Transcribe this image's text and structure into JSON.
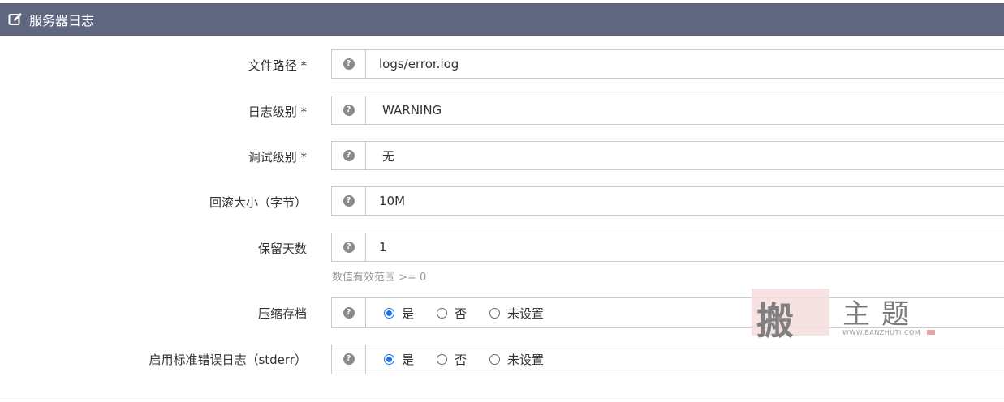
{
  "header": {
    "title": "服务器日志",
    "icon": "edit-icon"
  },
  "fields": [
    {
      "label": "文件路径 *",
      "value": "logs/error.log"
    },
    {
      "label": "日志级别 *",
      "value": "WARNING"
    },
    {
      "label": "调试级别 *",
      "value": "无"
    },
    {
      "label": "回滚大小（字节）",
      "value": "10M"
    },
    {
      "label": "保留天数",
      "value": "1",
      "help": "数值有效范围 >= 0"
    },
    {
      "label": "压缩存档",
      "options": [
        "是",
        "否",
        "未设置"
      ],
      "selected": "是"
    },
    {
      "label": "启用标准错误日志（stderr）",
      "options": [
        "是",
        "否",
        "未设置"
      ],
      "selected": "是"
    }
  ],
  "help_icon": "?",
  "watermark": {
    "seal": "搬",
    "text": "主题",
    "url": "WWW.BANZHUTI.COM"
  },
  "colors": {
    "header_bg": "#5f6680",
    "radio_accent": "#1a73e8",
    "border": "#cccccc"
  }
}
